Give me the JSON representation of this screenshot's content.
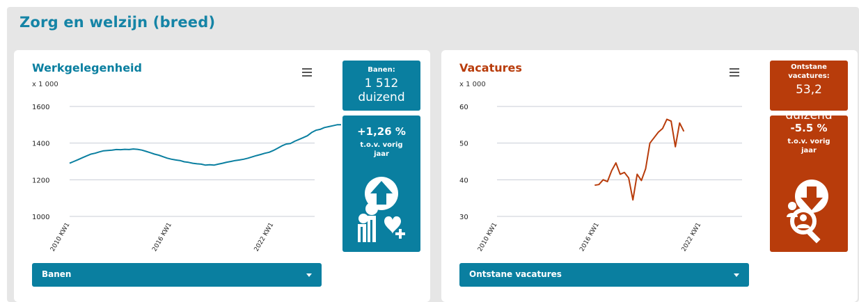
{
  "page": {
    "title": "Zorg en welzijn (breed)"
  },
  "colors": {
    "teal": "#0a7fa0",
    "orange": "#b83c0b",
    "grid": "#c8cdd6"
  },
  "left": {
    "title": "Werkgelegenheid",
    "unit": "x 1 000",
    "stat": {
      "label": "Banen:",
      "value": "1 512",
      "unit": "duizend",
      "change": "+1,26 %",
      "change_label": "t.o.v. vorig jaar",
      "icon": "arrow-up-people-heart-icon"
    },
    "dropdown": {
      "selected": "Banen"
    }
  },
  "right": {
    "title": "Vacatures",
    "unit": "x 1 000",
    "stat": {
      "label": "Ontstane vacatures:",
      "value": "53,2",
      "unit": "duizend",
      "change": "-5.5 %",
      "change_label": "t.o.v. vorig jaar",
      "icon": "arrow-down-magnifier-person-icon"
    },
    "dropdown": {
      "selected": "Ontstane vacatures"
    }
  },
  "chart_data": [
    {
      "type": "line",
      "title": "Werkgelegenheid",
      "ylabel": "x 1 000",
      "ylim": [
        1000,
        1600
      ],
      "yticks": [
        1000,
        1200,
        1400,
        1600
      ],
      "x_tick_labels": [
        "2010 KW1",
        "2016 KW1",
        "2022 KW1"
      ],
      "grid": true,
      "series": [
        {
          "name": "Banen",
          "x_start_quarter": "2010 KW1",
          "values": [
            1290,
            1300,
            1310,
            1320,
            1330,
            1340,
            1345,
            1352,
            1358,
            1360,
            1362,
            1365,
            1364,
            1366,
            1365,
            1368,
            1366,
            1362,
            1355,
            1348,
            1340,
            1334,
            1326,
            1318,
            1312,
            1308,
            1305,
            1298,
            1295,
            1290,
            1287,
            1285,
            1280,
            1282,
            1280,
            1285,
            1290,
            1296,
            1300,
            1305,
            1308,
            1312,
            1318,
            1325,
            1332,
            1338,
            1345,
            1350,
            1360,
            1372,
            1385,
            1395,
            1398,
            1410,
            1420,
            1430,
            1440,
            1458,
            1470,
            1475,
            1485,
            1490,
            1495,
            1500,
            1500,
            1480,
            1505,
            1510,
            1512
          ]
        }
      ]
    },
    {
      "type": "line",
      "title": "Vacatures",
      "ylabel": "x 1 000",
      "ylim": [
        30,
        60
      ],
      "yticks": [
        30,
        40,
        50,
        60
      ],
      "x_tick_labels": [
        "2010 KW1",
        "2016 KW1",
        "2022 KW1"
      ],
      "grid": true,
      "series": [
        {
          "name": "Ontstane vacatures",
          "x_start_quarter": "2015 KW4",
          "values": [
            38.5,
            38.7,
            40,
            39.5,
            42.5,
            44.6,
            41.5,
            42,
            40.5,
            34.5,
            41.5,
            39.8,
            43,
            50,
            51.5,
            53,
            54,
            56.5,
            56,
            49,
            55.5,
            53.2
          ]
        }
      ]
    }
  ]
}
